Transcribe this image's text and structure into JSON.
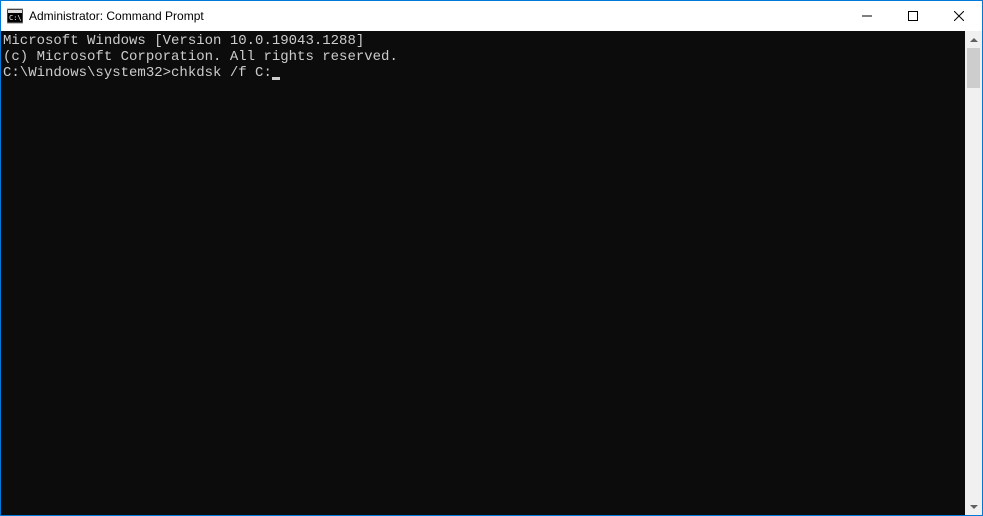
{
  "window": {
    "title": "Administrator: Command Prompt"
  },
  "terminal": {
    "line1": "Microsoft Windows [Version 10.0.19043.1288]",
    "line2": "(c) Microsoft Corporation. All rights reserved.",
    "blank": "",
    "prompt": "C:\\Windows\\system32>",
    "command": "chkdsk /f C:"
  }
}
